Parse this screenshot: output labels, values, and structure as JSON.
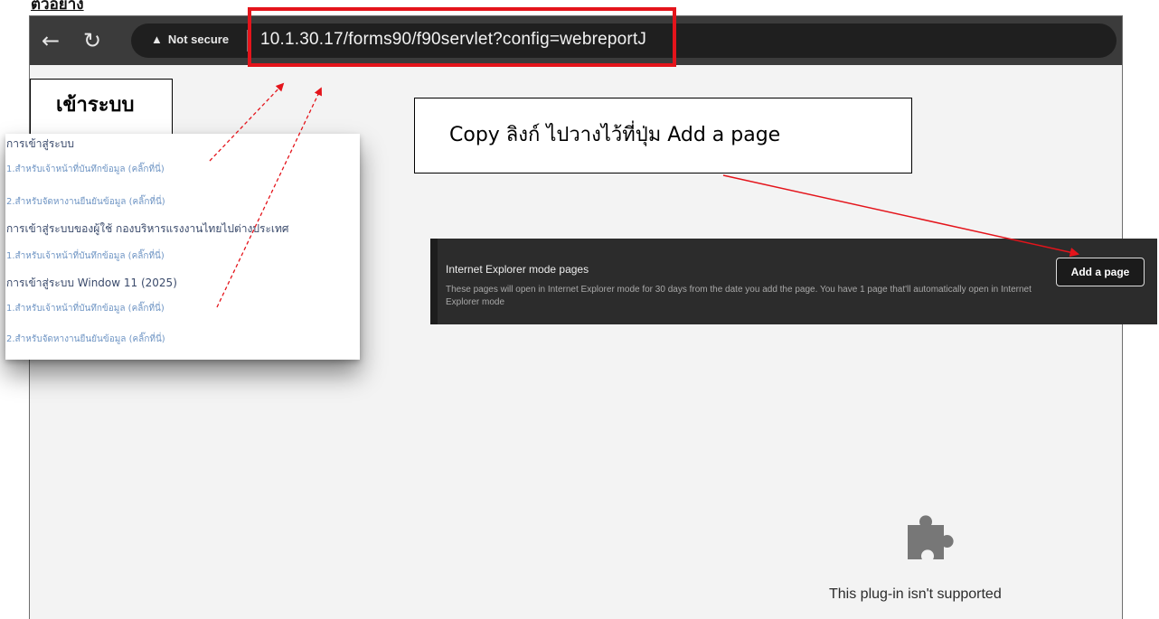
{
  "header_label": "ตัวอย่าง",
  "browser": {
    "back_icon": "arrow-left-icon",
    "reload_icon": "reload-icon",
    "security_icon": "warning-triangle-icon",
    "security_text": "Not secure",
    "url": "10.1.30.17/forms90/f90servlet?config=webreportJ"
  },
  "callouts": {
    "login_label": "เข้าระบบ",
    "copy_instruction": "Copy ลิงก์  ไปวางไว้ที่ปุ่ม Add a page"
  },
  "login_panel": {
    "items": [
      {
        "type": "heading",
        "text": "การเข้าสู่ระบบ"
      },
      {
        "type": "link",
        "text": "1.สำหรับเจ้าหน้าที่บันทึกข้อมูล (คลิ๊กที่นี่)"
      },
      {
        "type": "link",
        "text": "2.สำหรับจัดหางานยืนยันข้อมูล (คลิ๊กที่นี่)"
      },
      {
        "type": "heading",
        "text": "การเข้าสู่ระบบของผู้ใช้ กองบริหารแรงงานไทยไปต่างประเทศ"
      },
      {
        "type": "link",
        "text": "1.สำหรับเจ้าหน้าที่บันทึกข้อมูล (คลิ๊กที่นี่)"
      },
      {
        "type": "heading",
        "text": "การเข้าสู่ระบบ Window 11 (2025)"
      },
      {
        "type": "link",
        "text": "1.สำหรับเจ้าหน้าที่บันทึกข้อมูล (คลิ๊กที่นี่)"
      },
      {
        "type": "link",
        "text": "2.สำหรับจัดหางานยืนยันข้อมูล (คลิ๊กที่นี่)"
      }
    ]
  },
  "ie_mode": {
    "title": "Internet Explorer mode pages",
    "description": "These pages will open in Internet Explorer mode for 30 days from the date you add the page. You have 1 page that'll automatically open in Internet Explorer mode",
    "button_label": "Add a page"
  },
  "plugin": {
    "icon": "puzzle-piece-icon",
    "message": "This plug-in isn't supported"
  },
  "colors": {
    "annotation_red": "#e4141b",
    "toolbar_bg": "#3b3b3b",
    "link_blue": "#6f95c4",
    "heading_blue": "#3a4a6b"
  }
}
